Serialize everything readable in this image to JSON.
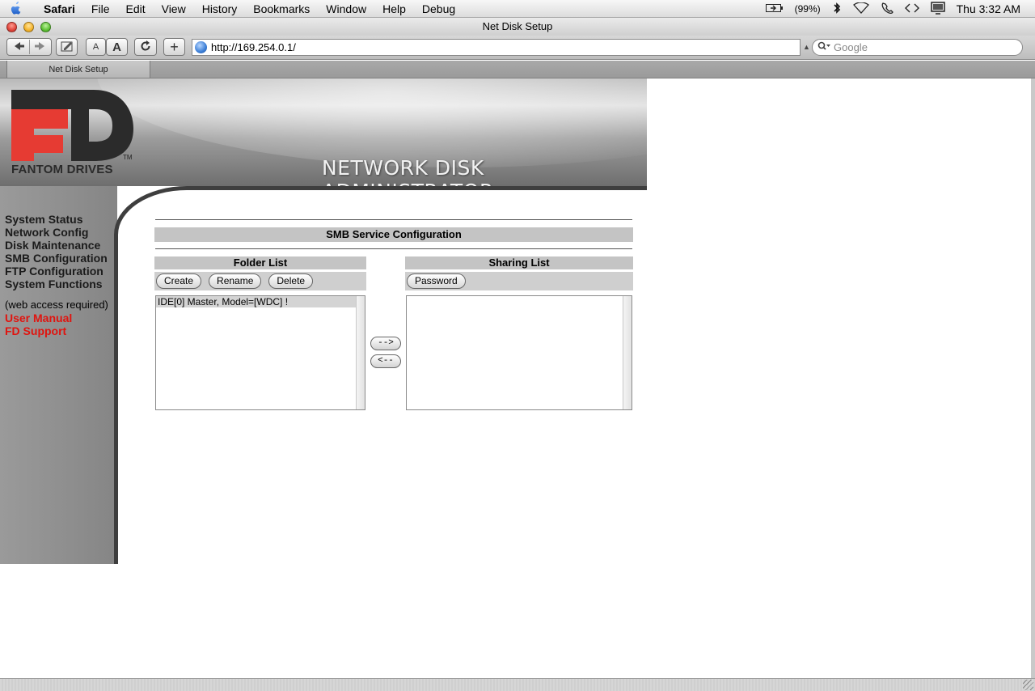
{
  "menubar": {
    "app": "Safari",
    "items": [
      "File",
      "Edit",
      "View",
      "History",
      "Bookmarks",
      "Window",
      "Help",
      "Debug"
    ],
    "battery": "(99%)",
    "clock": "Thu 3:32 AM"
  },
  "window": {
    "title": "Net Disk Setup",
    "text_small": "A",
    "text_large": "A",
    "add": "+",
    "url": "http://169.254.0.1/",
    "search_placeholder": "Google",
    "tab": "Net Disk Setup"
  },
  "banner": {
    "logo_caption": "FANTOM DRIVES",
    "tm": "TM",
    "title": "NETWORK DISK ADMINISTRATOR"
  },
  "nav": {
    "links": [
      "System Status",
      "Network Config",
      "Disk Maintenance",
      "SMB Configuration",
      "FTP Configuration",
      "System Functions"
    ],
    "note": "(web access required)",
    "user_manual": "User Manual",
    "support": "FD Support"
  },
  "smb": {
    "title": "SMB Service Configuration",
    "folder_list": {
      "header": "Folder List",
      "buttons": [
        "Create",
        "Rename",
        "Delete"
      ],
      "items": [
        "IDE[0] Master, Model=[WDC] !"
      ]
    },
    "sharing_list": {
      "header": "Sharing List",
      "buttons": [
        "Password"
      ],
      "items": []
    },
    "move_right": "-->",
    "move_left": "<--"
  },
  "colors": {
    "nav_red": "#e0140f",
    "banner_gray": "#9d9d9d"
  }
}
